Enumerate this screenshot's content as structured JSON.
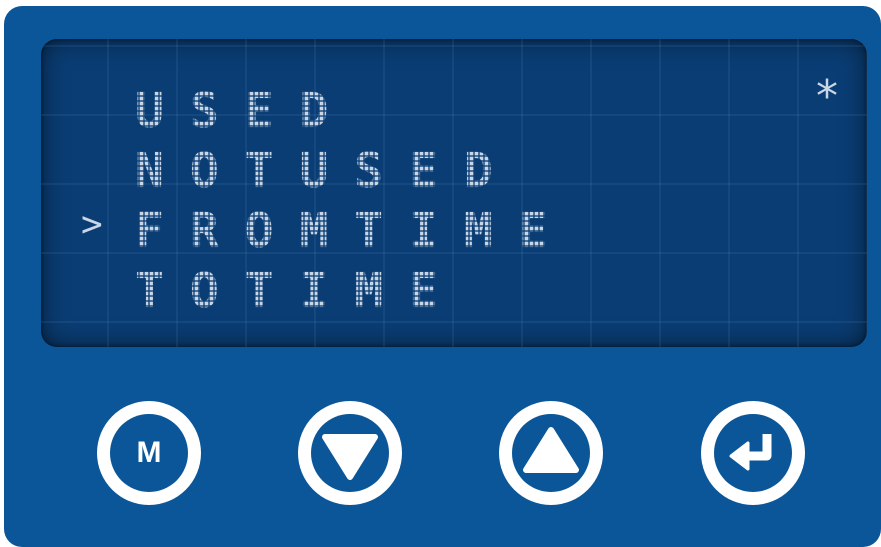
{
  "display": {
    "lines": [
      {
        "text": "USED",
        "selected": false
      },
      {
        "text": "NOTUSED",
        "selected": false
      },
      {
        "text": "FROMTIME",
        "selected": true
      },
      {
        "text": "TOTIME",
        "selected": false
      }
    ],
    "cursor_symbol": ">",
    "status_symbol": "*"
  },
  "buttons": {
    "menu_label": "M",
    "down_icon": "down-triangle-icon",
    "up_icon": "up-triangle-icon",
    "enter_icon": "enter-arrow-icon"
  },
  "colors": {
    "panel": "#0b5699",
    "screen": "#0a3d74",
    "segment_text": "#c9d6e6",
    "button_ring": "#ffffff"
  }
}
